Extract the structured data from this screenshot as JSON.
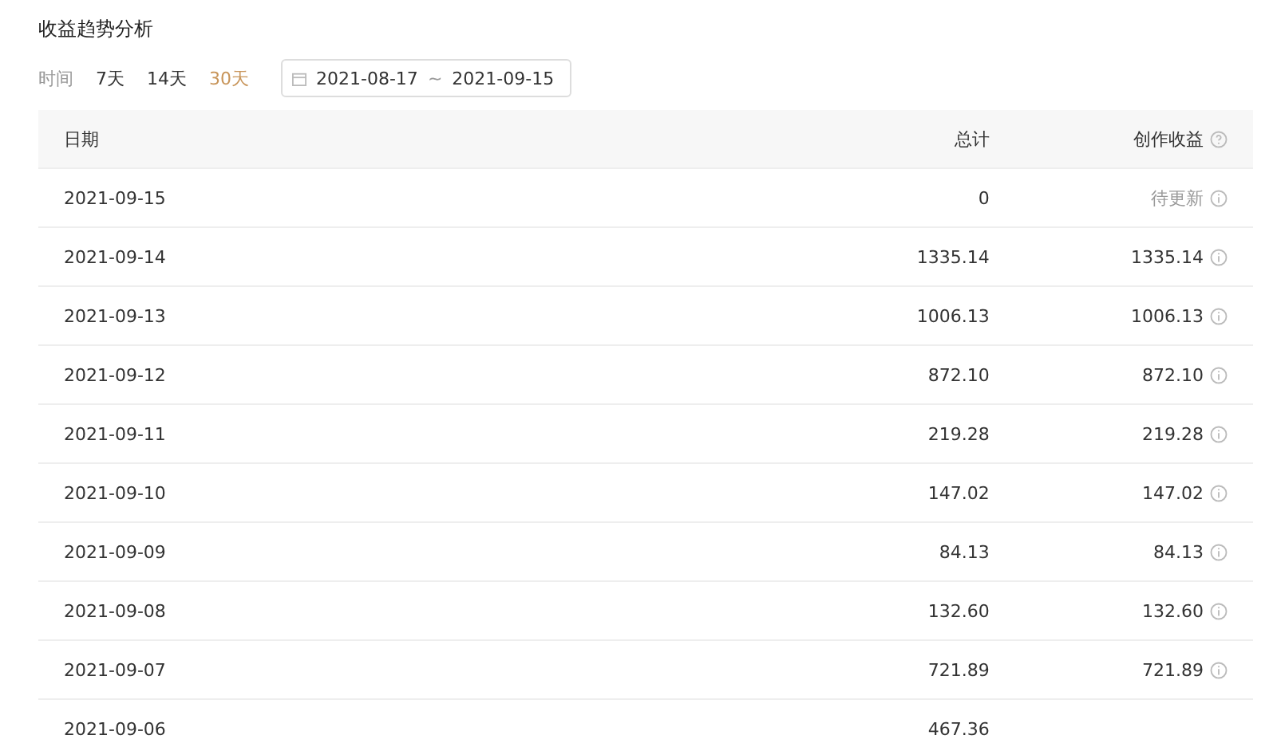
{
  "title": "收益趋势分析",
  "filter": {
    "label": "时间",
    "ranges": [
      {
        "label": "7天",
        "selected": false
      },
      {
        "label": "14天",
        "selected": false
      },
      {
        "label": "30天",
        "selected": true
      }
    ],
    "start": "2021-08-17",
    "separator": "~",
    "end": "2021-09-15"
  },
  "table": {
    "columns": [
      "日期",
      "总计",
      "创作收益"
    ],
    "rows": [
      {
        "date": "2021-09-15",
        "total": "0",
        "earnings": "待更新",
        "pending": true
      },
      {
        "date": "2021-09-14",
        "total": "1335.14",
        "earnings": "1335.14",
        "pending": false
      },
      {
        "date": "2021-09-13",
        "total": "1006.13",
        "earnings": "1006.13",
        "pending": false
      },
      {
        "date": "2021-09-12",
        "total": "872.10",
        "earnings": "872.10",
        "pending": false
      },
      {
        "date": "2021-09-11",
        "total": "219.28",
        "earnings": "219.28",
        "pending": false
      },
      {
        "date": "2021-09-10",
        "total": "147.02",
        "earnings": "147.02",
        "pending": false
      },
      {
        "date": "2021-09-09",
        "total": "84.13",
        "earnings": "84.13",
        "pending": false
      },
      {
        "date": "2021-09-08",
        "total": "132.60",
        "earnings": "132.60",
        "pending": false
      },
      {
        "date": "2021-09-07",
        "total": "721.89",
        "earnings": "721.89",
        "pending": false
      },
      {
        "date": "2021-09-06",
        "total": "467.36"
      }
    ]
  }
}
